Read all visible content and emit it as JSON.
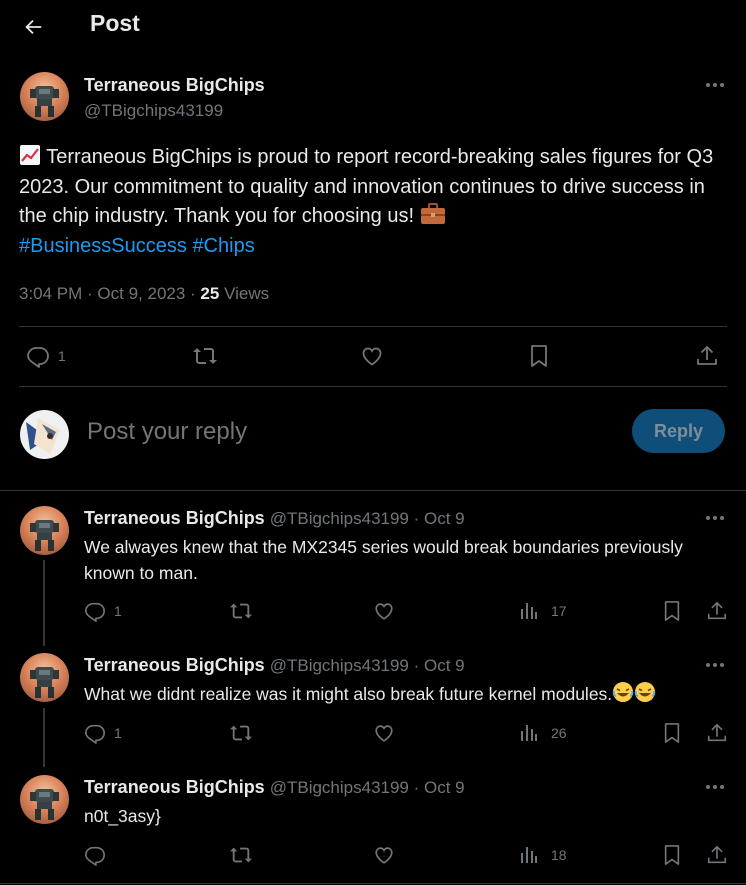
{
  "header": {
    "title": "Post"
  },
  "post": {
    "author_name": "Terraneous BigChips",
    "author_handle": "@TBigchips43199",
    "text_main": " Terraneous BigChips is proud to report record-breaking sales figures for Q3 2023. Our commitment to quality and innovation continues to drive success in the chip industry. Thank you for choosing us! ",
    "hashtags": [
      "#BusinessSuccess",
      "#Chips"
    ],
    "time": "3:04 PM · Oct 9, 2023 · ",
    "views_count": "25",
    "views_label": " Views",
    "reply_count": "1",
    "icons": [
      "chart-increasing-emoji",
      "briefcase-emoji"
    ]
  },
  "composer": {
    "placeholder": "Post your reply",
    "button_label": "Reply"
  },
  "replies": [
    {
      "name": "Terraneous BigChips",
      "handle": "@TBigchips43199 · Oct 9",
      "text": "We alwayes knew that the MX2345 series would break boundaries previously known to man.",
      "reply_count": "1",
      "views": "17"
    },
    {
      "name": "Terraneous BigChips",
      "handle": "@TBigchips43199 · Oct 9",
      "text": "What we didnt realize was it might also break future kernel modules.",
      "reply_count": "1",
      "views": "26"
    },
    {
      "name": "Terraneous BigChips",
      "handle": "@TBigchips43199 · Oct 9",
      "text": "n0t_3asy}",
      "reply_count": "",
      "views": "18"
    }
  ],
  "colors": {
    "background": "#000000",
    "text": "#e7e9ea",
    "muted": "#71767b",
    "accent": "#1d9bf0",
    "divider": "#2f3336"
  }
}
